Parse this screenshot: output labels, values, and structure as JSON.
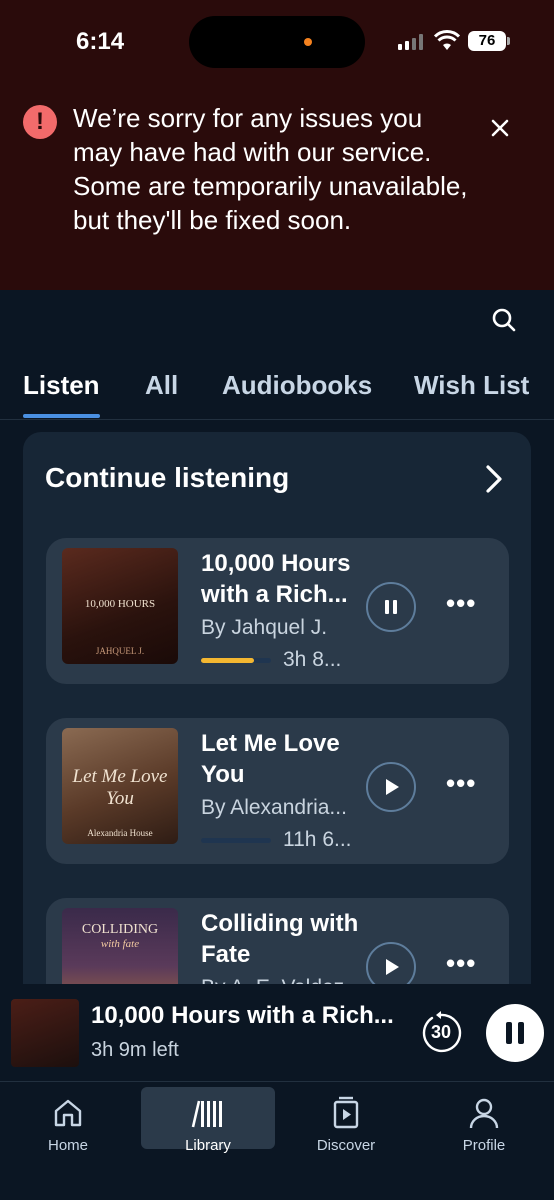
{
  "status_bar": {
    "time": "6:14",
    "battery": "76"
  },
  "alert": {
    "message": "We’re sorry for any issues you may have had with our service. Some are temporarily unavailable, but they'll be fixed soon."
  },
  "tabs": [
    {
      "label": "Listen",
      "active": true
    },
    {
      "label": "All",
      "active": false
    },
    {
      "label": "Audiobooks",
      "active": false
    },
    {
      "label": "Wish List",
      "active": false
    }
  ],
  "continue_listening": {
    "title": "Continue listening",
    "items": [
      {
        "title": "10,000 Hours with a Rich...",
        "author": "By Jahquel J.",
        "time_left": "3h 8...",
        "progress": 0.75,
        "state": "pause",
        "cover_text": "10,000 HOURS",
        "cover_author": "JAHQUEL J."
      },
      {
        "title": "Let Me Love You",
        "author": "By Alexandria...",
        "time_left": "11h 6...",
        "progress": 0,
        "state": "play",
        "cover_text": "Let Me Love You",
        "cover_author": "Alexandria House"
      },
      {
        "title": "Colliding with Fate",
        "author": "By A. E. Valdez",
        "time_left": "",
        "progress": 0,
        "state": "play",
        "cover_text": "COLLIDING",
        "cover_author": "with fate"
      }
    ]
  },
  "mini_player": {
    "title": "10,000 Hours with a Rich...",
    "subtitle": "3h 9m left",
    "skip_seconds": "30"
  },
  "bottom_nav": [
    {
      "label": "Home",
      "icon": "home-icon",
      "active": false
    },
    {
      "label": "Library",
      "icon": "library-icon",
      "active": true
    },
    {
      "label": "Discover",
      "icon": "discover-icon",
      "active": false
    },
    {
      "label": "Profile",
      "icon": "profile-icon",
      "active": false
    }
  ],
  "colors": {
    "alert_bg": "#2a0b0b",
    "app_bg": "#0b1623",
    "card_bg": "#172636",
    "item_bg": "#2b3a4a",
    "progress": "#f4b731",
    "tab_indicator": "#4a90e2"
  }
}
